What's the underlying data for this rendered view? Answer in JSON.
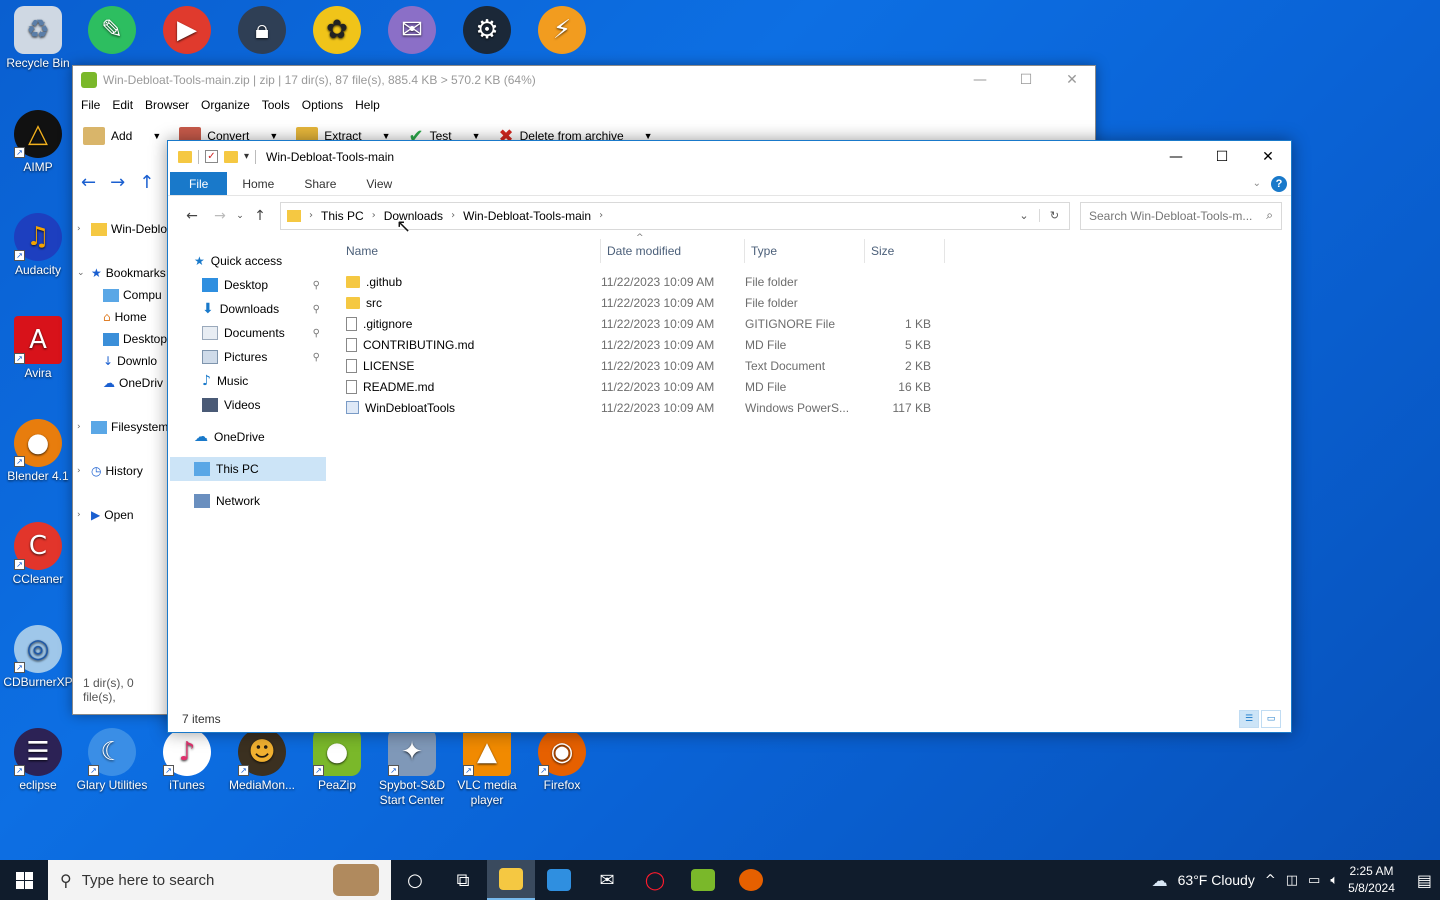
{
  "desktop": {
    "icons_left": [
      "Recycle Bin",
      "AIMP",
      "Audacity",
      "Avira",
      "Blender 4.1",
      "CCleaner",
      "CDBurnerXP",
      "eclipse"
    ],
    "icons_bottom": [
      "Glary Utilities",
      "iTunes",
      "MediaMon...",
      "PeaZip",
      "Spybot-S&D Start Center",
      "VLC media player",
      "Firefox"
    ]
  },
  "peazip": {
    "title": "Win-Debloat-Tools-main.zip | zip | 17 dir(s), 87 file(s), 885.4 KB > 570.2 KB (64%)",
    "menu": [
      "File",
      "Edit",
      "Browser",
      "Organize",
      "Tools",
      "Options",
      "Help"
    ],
    "toolbar": [
      "Add",
      "Convert",
      "Extract",
      "Test",
      "Delete from archive"
    ],
    "tree": [
      "Win-Deblo",
      "Bookmarks",
      "Compu",
      "Home",
      "Desktop",
      "Downlo",
      "OneDriv",
      "Filesystem",
      "History",
      "Open"
    ],
    "status": "1 dir(s), 0 file(s),"
  },
  "explorer": {
    "title": "Win-Debloat-Tools-main",
    "ribbon_tabs": [
      "File",
      "Home",
      "Share",
      "View"
    ],
    "breadcrumb": [
      "This PC",
      "Downloads",
      "Win-Debloat-Tools-main"
    ],
    "search_placeholder": "Search Win-Debloat-Tools-m...",
    "nav": {
      "quick_access": "Quick access",
      "items": [
        "Desktop",
        "Downloads",
        "Documents",
        "Pictures",
        "Music",
        "Videos"
      ],
      "onedrive": "OneDrive",
      "this_pc": "This PC",
      "network": "Network"
    },
    "columns": [
      "Name",
      "Date modified",
      "Type",
      "Size"
    ],
    "files": [
      {
        "name": ".github",
        "date": "11/22/2023 10:09 AM",
        "type": "File folder",
        "size": "",
        "icon": "folder"
      },
      {
        "name": "src",
        "date": "11/22/2023 10:09 AM",
        "type": "File folder",
        "size": "",
        "icon": "folder"
      },
      {
        "name": ".gitignore",
        "date": "11/22/2023 10:09 AM",
        "type": "GITIGNORE File",
        "size": "1 KB",
        "icon": "file"
      },
      {
        "name": "CONTRIBUTING.md",
        "date": "11/22/2023 10:09 AM",
        "type": "MD File",
        "size": "5 KB",
        "icon": "file"
      },
      {
        "name": "LICENSE",
        "date": "11/22/2023 10:09 AM",
        "type": "Text Document",
        "size": "2 KB",
        "icon": "file"
      },
      {
        "name": "README.md",
        "date": "11/22/2023 10:09 AM",
        "type": "MD File",
        "size": "16 KB",
        "icon": "file"
      },
      {
        "name": "WinDebloatTools",
        "date": "11/22/2023 10:09 AM",
        "type": "Windows PowerS...",
        "size": "117 KB",
        "icon": "powershell"
      }
    ],
    "status": "7 items"
  },
  "taskbar": {
    "search_placeholder": "Type here to search",
    "weather": "63°F  Cloudy",
    "time": "2:25 AM",
    "date": "5/8/2024"
  },
  "colors": {
    "accent": "#1979ca",
    "desktop": "#0a5fd0",
    "folder": "#f5c842"
  }
}
